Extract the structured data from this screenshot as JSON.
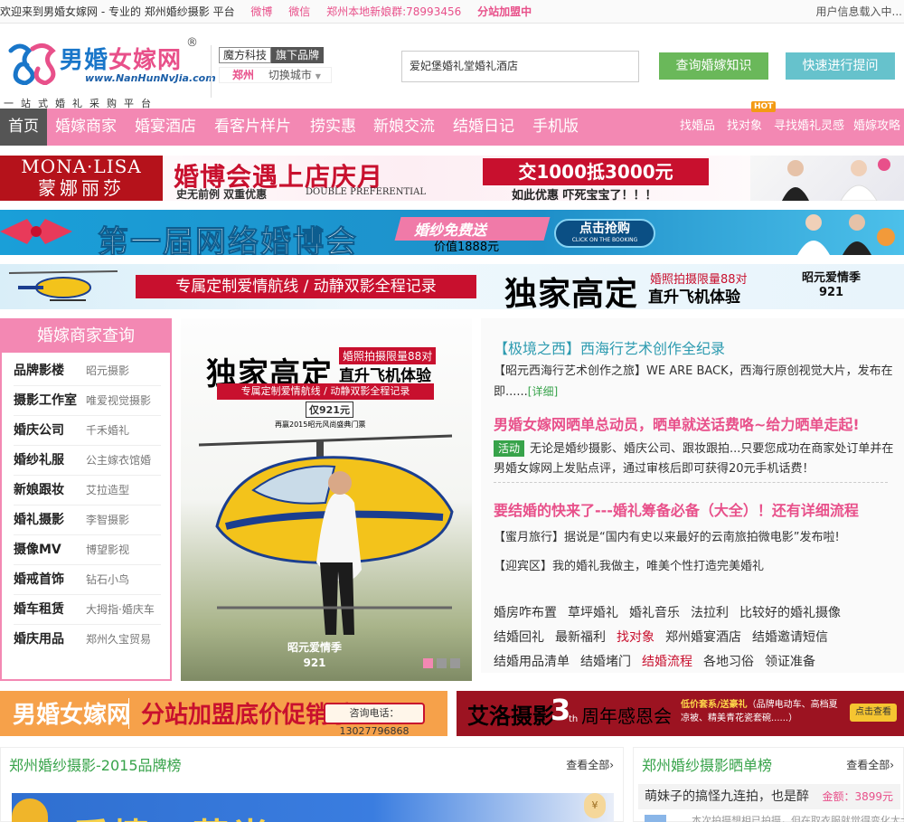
{
  "topbar": {
    "welcome": "欢迎来到男婚女嫁网 - 专业的 郑州婚纱摄影 平台",
    "weibo": "微博",
    "weixin": "微信",
    "qq_group": "郑州本地新娘群:78993456",
    "franchise": "分站加盟中",
    "user_status": "用户信息载入中..."
  },
  "header": {
    "logo_name_1": "男婚",
    "logo_name_2": "女嫁网",
    "logo_reg": "®",
    "logo_url": "www.NanHunNvJia.com",
    "logo_slogan": "一站式婚礼采购平台",
    "brand_company": "魔方科技",
    "brand_tag": "旗下品牌",
    "city": "郑州",
    "switch_city": "切换城市",
    "search_value": "爱妃堡婚礼堂婚礼酒店",
    "btn_knowledge": "查询婚嫁知识",
    "btn_ask": "快速进行提问"
  },
  "nav": {
    "main": [
      "首页",
      "婚嫁商家",
      "婚宴酒店",
      "看客片样片",
      "捞实惠",
      "新娘交流",
      "结婚日记",
      "手机版"
    ],
    "sub": [
      "找婚品",
      "找对象",
      "寻找婚礼灵感",
      "婚嫁攻略"
    ],
    "hot_badge": "HOT"
  },
  "banner1": {
    "brand_en": "MONA·LISA",
    "brand_cn": "蒙娜丽莎",
    "headline": "婚博会遇上店庆月",
    "sub1": "史无前例 双重优惠",
    "sub2": "DOUBLE PREFERENTIAL",
    "offer": "交1000抵3000元",
    "offer_sub": "如此优惠 吓死宝宝了！！！"
  },
  "banner2": {
    "headline": "第一届网络婚博会",
    "free": "婚纱免费送",
    "price": "价值1888元",
    "cta": "点击抢购",
    "cta_small": "CLICK ON THE BOOKING"
  },
  "banner3": {
    "route": "专属定制爱情航线 / 动静双影全程记录",
    "exclusive": "独家高定",
    "limit": "婚照拍摄限量88对",
    "heli": "直升飞机体验",
    "sig_1": "昭元爱情季",
    "sig_2": "921"
  },
  "merchant_box": {
    "title": "婚嫁商家查询",
    "rows": [
      {
        "k": "品牌影楼",
        "v": "昭元摄影"
      },
      {
        "k": "摄影工作室",
        "v": "唯爱视觉摄影"
      },
      {
        "k": "婚庆公司",
        "v": "千禾婚礼"
      },
      {
        "k": "婚纱礼服",
        "v": "公主嫁衣馆婚"
      },
      {
        "k": "新娘跟妆",
        "v": "艾拉造型"
      },
      {
        "k": "婚礼摄影",
        "v": "李智摄影"
      },
      {
        "k": "摄像MV",
        "v": "博望影视"
      },
      {
        "k": "婚戒首饰",
        "v": "钻石小鸟"
      },
      {
        "k": "婚车租赁",
        "v": "大拇指·婚庆车"
      },
      {
        "k": "婚庆用品",
        "v": "郑州久宝贸易"
      }
    ]
  },
  "poster": {
    "title": "独家高定",
    "tag": "婚照拍摄限量88对",
    "heli": "直升飞机体验",
    "strip": "专属定制爱情航线 / 动静双影全程记录",
    "price": "仅921元",
    "sub": "再赢2015昭元风尚盛典门票",
    "sig_1": "昭元爱情季",
    "sig_2": "921"
  },
  "news": {
    "h1": "【极境之西】西海行艺术创作全纪录",
    "p1": "【昭元西海行艺术创作之旅】WE ARE BACK，西海行原创视觉大片，发布在即......",
    "p1_more": "[详细]",
    "h2": "男婚女嫁网晒单总动员，晒单就送话费咯~给力晒单走起!",
    "badge": "活动",
    "p2": "无论是婚纱摄影、婚庆公司、跟妆跟拍...只要您成功在商家处订单并在男婚女嫁网上发贴点评，通过审核后即可获得20元手机话费！",
    "h3": "要结婚的快来了---婚礼筹备必备（大全）！还有详细流程",
    "l1": "【蜜月旅行】据说是“国内有史以来最好的云南旅拍微电影”发布啦!",
    "l2": "【迎宾区】我的婚礼我做主，唯美个性打造完美婚礼",
    "tags": [
      [
        "婚房咋布置",
        "草坪婚礼",
        "婚礼音乐",
        "法拉利",
        "比较好的婚礼摄像"
      ],
      [
        "结婚回礼",
        "最新福利",
        "找对象",
        "郑州婚宴酒店",
        "结婚邀请短信"
      ],
      [
        "结婚用品清单",
        "结婚堵门",
        "结婚流程",
        "各地习俗",
        "领证准备"
      ]
    ]
  },
  "bottom_banners": {
    "b1_logo": "男婚女嫁网",
    "b1_promo": "分站加盟底价促销季",
    "b1_phone": "咨询电话：13027796868",
    "b2_name": "艾洛摄影",
    "b2_num": "3",
    "b2_th": "th",
    "b2_event": "周年感恩会",
    "b2_small_1": "低价套系/送豪礼",
    "b2_small_2": "（品牌电动车、高档夏凉被、精美青花瓷套碗......）",
    "b2_btn": "点击查看"
  },
  "sections": {
    "left_title": "郑州婚纱摄影-2015品牌榜",
    "left_more": "查看全部›",
    "left_img_text": "爱情の芬尚",
    "left_coin": "¥",
    "right_title": "郑州婚纱摄影晒单榜",
    "right_more": "查看全部›",
    "right_item": "萌妹子的搞怪九连拍，也是醉",
    "right_amount_label": "金额：",
    "right_amount": "3899元",
    "right_next": "本次拍摄想相已拍摄，但在取衣服就觉得变化太大"
  },
  "colors": {
    "pink": "#f388b3",
    "green": "#6ab85a",
    "teal": "#66c2cc",
    "red": "#c8102e"
  }
}
